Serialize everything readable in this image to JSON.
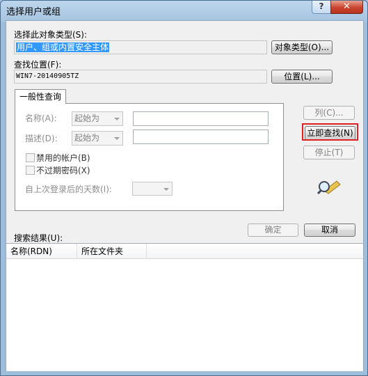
{
  "window": {
    "title": "选择用户或组",
    "help": "?",
    "close": "✕"
  },
  "object_type": {
    "label": "选择此对象类型(S):",
    "value": "用户、组或内置安全主体",
    "button": "对象类型(O)..."
  },
  "location": {
    "label": "查找位置(F):",
    "value": "WIN7-20140905TZ",
    "button": "位置(L)..."
  },
  "query_tab": {
    "label": "一般性查询"
  },
  "name_row": {
    "label": "名称(A):",
    "mode": "起始为",
    "value": ""
  },
  "desc_row": {
    "label": "描述(D):",
    "mode": "起始为",
    "value": ""
  },
  "checkboxes": [
    {
      "label": "禁用的帐户(B)"
    },
    {
      "label": "不过期密码(X)"
    }
  ],
  "days": {
    "label": "自上次登录后的天数(I):",
    "value": ""
  },
  "side_buttons": {
    "columns": "列(C)...",
    "find_now": "立即查找(N)",
    "stop": "停止(T)"
  },
  "footer": {
    "ok": "确定",
    "cancel": "取消"
  },
  "results": {
    "label": "搜索结果(U):",
    "columns": [
      "名称(RDN)",
      "所在文件夹"
    ]
  },
  "colors": {
    "highlight": "#e02020",
    "selection": "#3399ff"
  },
  "icons": [
    "search-icon"
  ]
}
